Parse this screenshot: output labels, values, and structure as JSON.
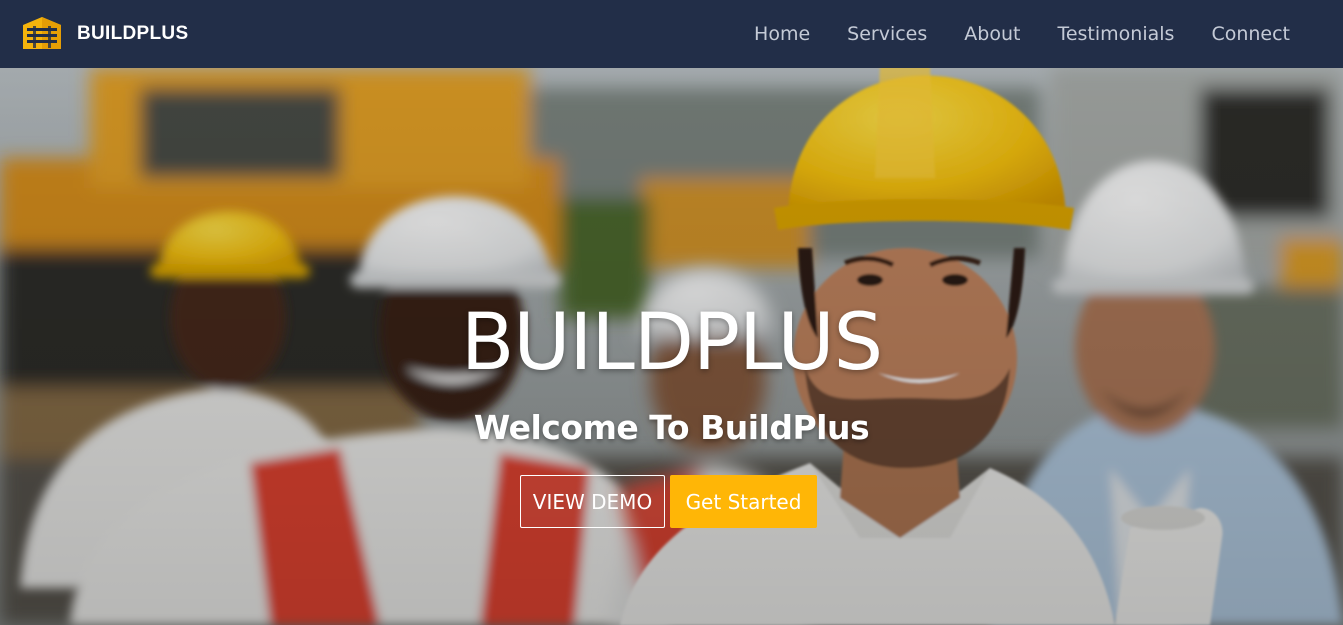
{
  "brand": {
    "name": "BUILDPLUS",
    "logo_icon": "building-icon",
    "accent_color": "#f5b40c"
  },
  "nav": {
    "items": [
      {
        "label": "Home"
      },
      {
        "label": "Services"
      },
      {
        "label": "About"
      },
      {
        "label": "Testimonials"
      },
      {
        "label": "Connect"
      }
    ]
  },
  "hero": {
    "title": "BUILDPLUS",
    "subtitle": "Welcome To BuildPlus",
    "buttons": {
      "demo_label": "VIEW DEMO",
      "start_label": "Get Started"
    },
    "image_description": "construction-workers-photo"
  },
  "colors": {
    "navbar": "#222e48",
    "nav_text": "#c4cad6",
    "primary_button": "#ffb606"
  }
}
